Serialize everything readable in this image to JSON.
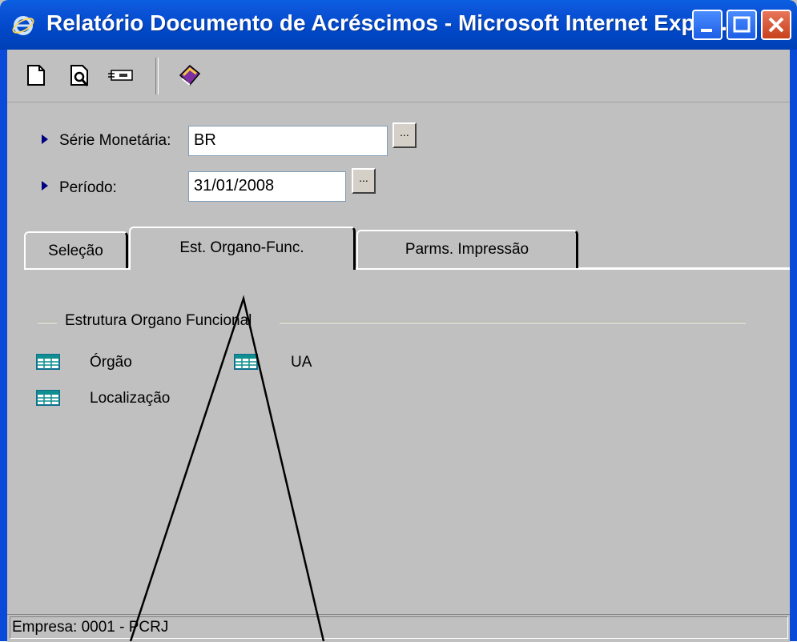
{
  "window": {
    "title": "Relatório Documento de Acréscimos - Microsoft Internet Explo...",
    "controls": [
      "minimize",
      "maximize",
      "close"
    ]
  },
  "toolbar": {
    "icons": [
      "new-page-icon",
      "print-preview-icon",
      "send-icon",
      "help-book-icon"
    ]
  },
  "fields": {
    "serie_label": "Série Monetária:",
    "serie_value": "BR",
    "periodo_label": "Período:",
    "periodo_value": "31/01/2008",
    "lookup_button": "..."
  },
  "tabs": [
    {
      "label": "Seleção",
      "active": false
    },
    {
      "label": "Est. Organo-Func.",
      "active": true
    },
    {
      "label": "Parms. Impressão",
      "active": false
    }
  ],
  "panel": {
    "group_title": "Estrutura Organo Funcional",
    "items": [
      {
        "label": "Órgão"
      },
      {
        "label": "UA"
      },
      {
        "label": "Localização"
      }
    ]
  },
  "status": {
    "text": "Empresa: 0001 - PCRJ"
  },
  "colors": {
    "titlebar": "#0048c8",
    "background": "#c0c0c0",
    "accent_arrow": "#000080",
    "grid_icon": "#0f8f8f"
  }
}
